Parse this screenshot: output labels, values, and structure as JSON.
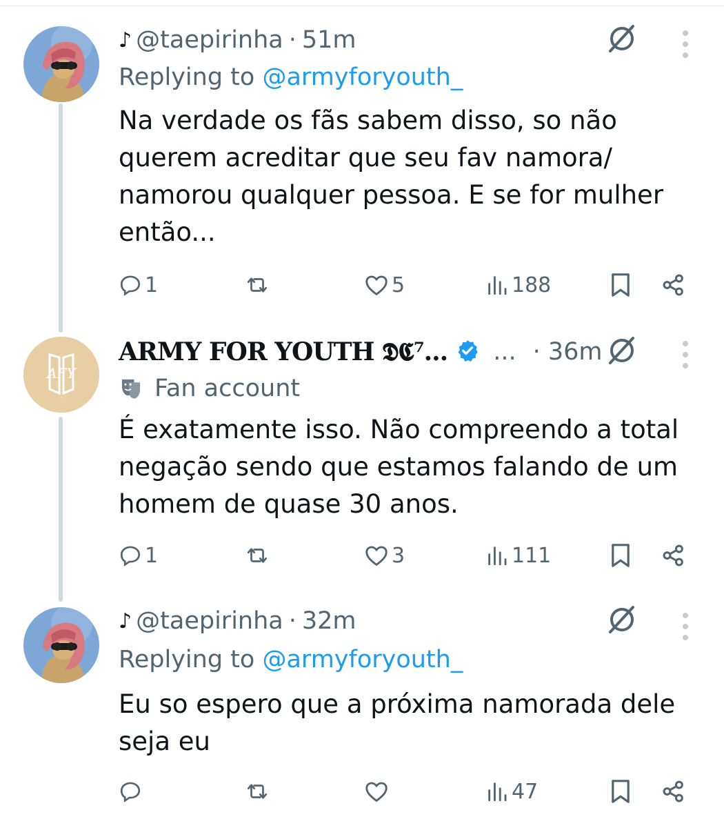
{
  "tweets": [
    {
      "display_prefix": "♪",
      "handle": "@taepirinha",
      "time": "51m",
      "replying_label": "Replying to",
      "replying_to": "@armyforyouth_",
      "text": "Na verdade os fãs sabem disso, so não querem acreditar que seu fav namora/ namorou qualquer pessoa. E se for mulher então...",
      "replies": "1",
      "reposts": "",
      "likes": "5",
      "views": "188",
      "avatar": "cat-with-headscarf-and-sunglasses"
    },
    {
      "name": "ARMY FOR YOUTH 𝕯𝕮⁷...",
      "ellipsis": "...",
      "time": "· 36m",
      "label": "Fan account",
      "text": "É exatamente isso. Não compreendo a total negação sendo que estamos falando de um homem de quase 30 anos.",
      "replies": "1",
      "reposts": "",
      "likes": "3",
      "views": "111",
      "avatar": "afy-logo-beige",
      "verified_color": "#1d9bf0"
    },
    {
      "display_prefix": "♪",
      "handle": "@taepirinha",
      "time": "32m",
      "replying_label": "Replying to",
      "replying_to": "@armyforyouth_",
      "text": "Eu so espero que a próxima namorada dele seja eu",
      "replies": "",
      "reposts": "",
      "likes": "",
      "views": "47",
      "avatar": "cat-with-headscarf-and-sunglasses"
    }
  ],
  "colors": {
    "secondary_text": "#536471",
    "link": "#1d9bf0",
    "thread_line": "#cfd9de",
    "avatar_afy_bg": "#e8cfa3"
  }
}
